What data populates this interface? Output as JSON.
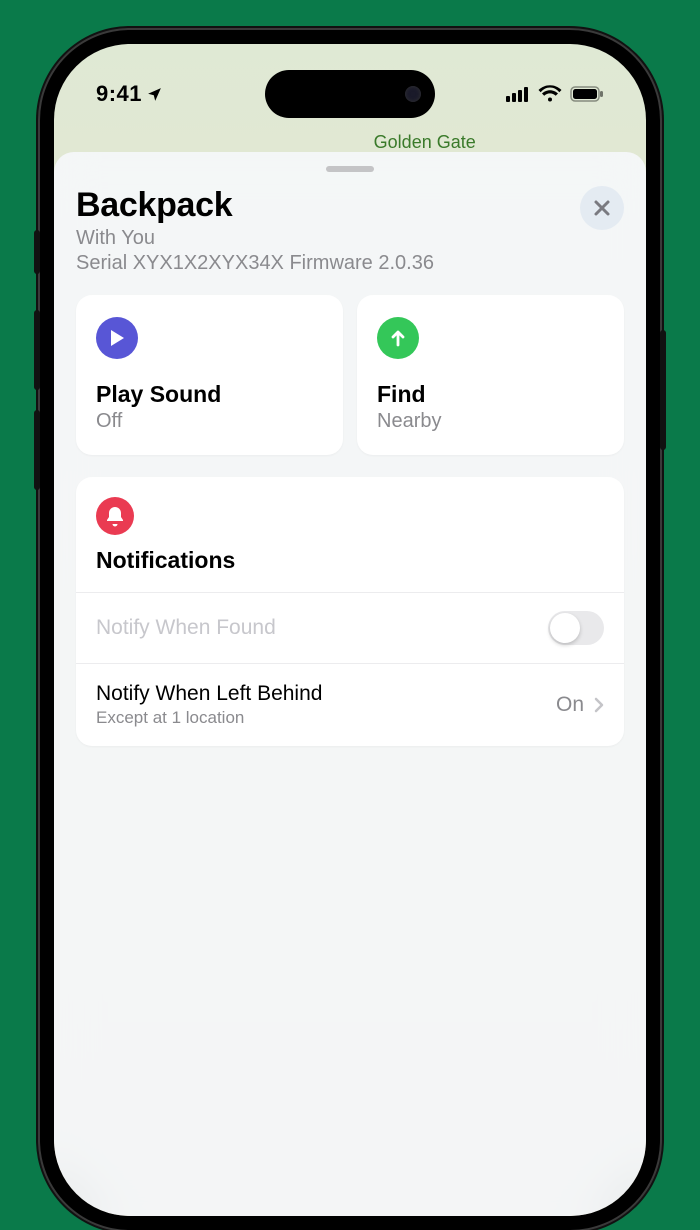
{
  "status_bar": {
    "time": "9:41"
  },
  "map": {
    "label": "Golden Gate"
  },
  "item": {
    "name": "Backpack",
    "status": "With You",
    "details": "Serial XYX1X2XYX34X Firmware 2.0.36"
  },
  "actions": {
    "play_sound": {
      "title": "Play Sound",
      "status": "Off"
    },
    "find": {
      "title": "Find",
      "status": "Nearby"
    }
  },
  "notifications": {
    "heading": "Notifications",
    "when_found": {
      "label": "Notify When Found",
      "toggle": "off",
      "enabled": false
    },
    "left_behind": {
      "label": "Notify When Left Behind",
      "sub": "Except at 1 location",
      "value": "On"
    }
  }
}
